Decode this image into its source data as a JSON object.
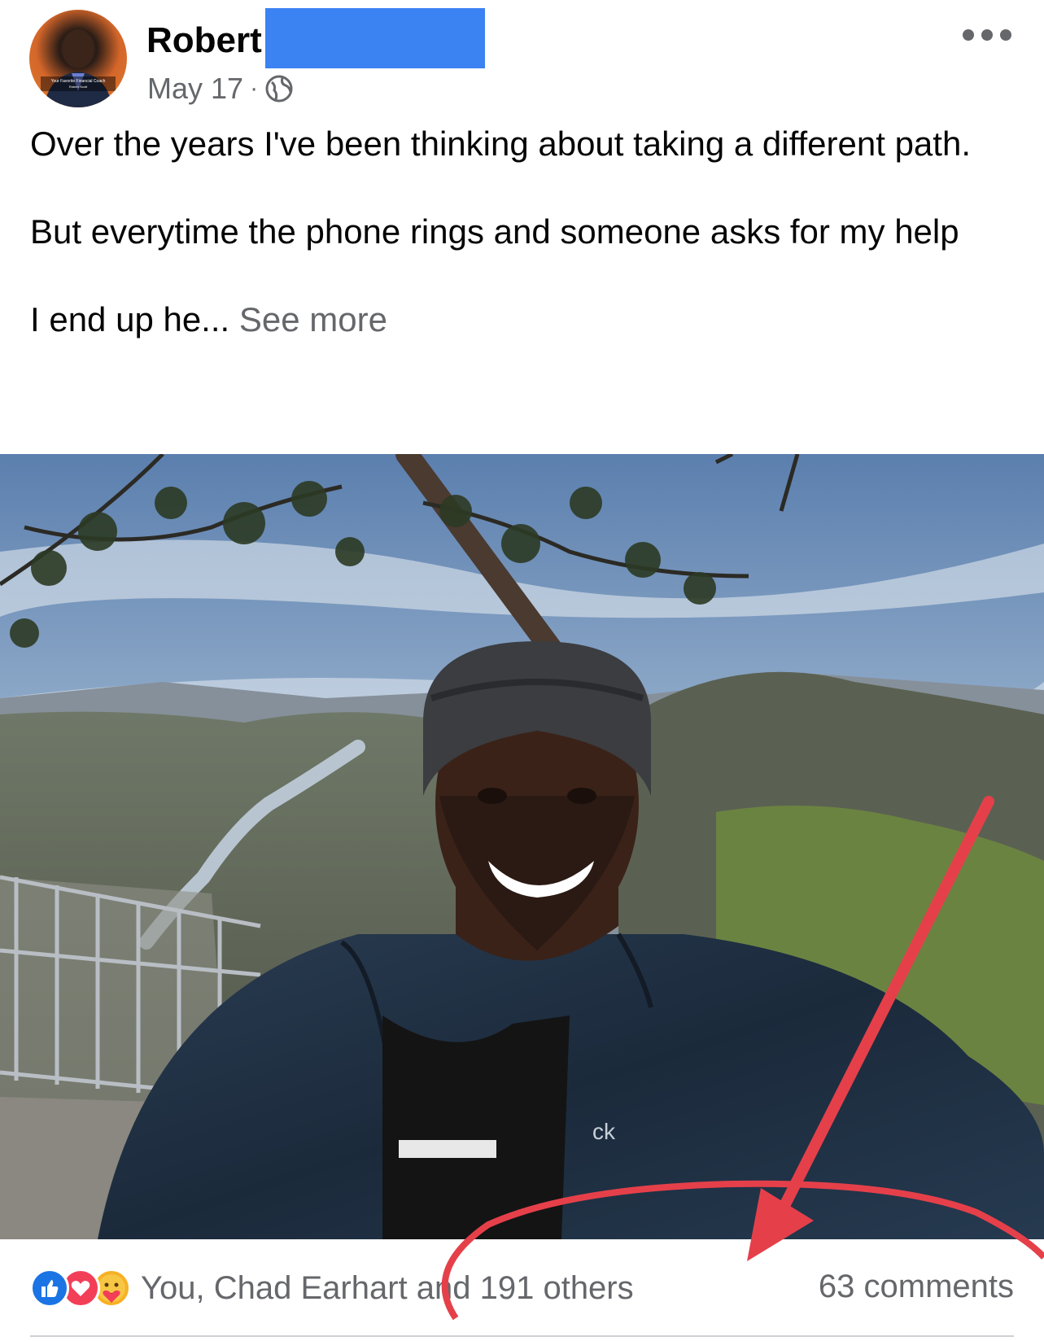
{
  "post": {
    "author_name": "Robert",
    "date": "May 17",
    "separator": "·",
    "privacy_icon": "globe-icon",
    "more_icon": "more-options-icon",
    "text_lines": [
      "Over the years I've been thinking about taking a different path.",
      "But everytime the phone rings and someone asks for my help"
    ],
    "truncated_line": "I end up he...",
    "see_more_label": "See more",
    "avatar_caption": "Your Favorite Financial Coach",
    "avatar_subcaption": "Robert Scott",
    "photo_jacket_logo": "ck"
  },
  "reactions": {
    "icons": [
      "like-icon",
      "love-icon",
      "care-icon"
    ],
    "summary_text": "You, Chad Earhart and 191 others",
    "comments_label": "63 comments"
  },
  "colors": {
    "like": "#1b74e4",
    "love": "#f33e58",
    "care": "#f7b125",
    "redaction": "#3b82f3",
    "annotation": "#e5404a",
    "muted_text": "#65676b"
  }
}
